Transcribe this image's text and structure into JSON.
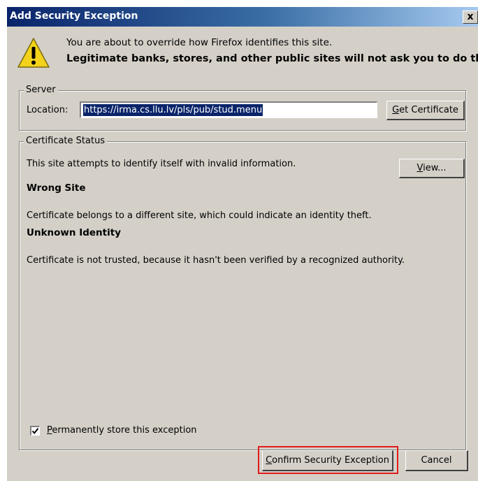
{
  "dialog": {
    "title": "Add Security Exception",
    "close_symbol": "x"
  },
  "intro": {
    "line1": "You are about to override how Firefox identifies this site.",
    "line2": "Legitimate banks, stores, and other public sites will not ask you to do this."
  },
  "icons": {
    "warning": "warning-icon",
    "check": "checkmark-icon"
  },
  "server": {
    "legend": "Server",
    "location_label": "Location:",
    "location_value": "https://irma.cs.llu.lv/pls/pub/stud.menu",
    "get_certificate": {
      "mnemonic": "G",
      "rest": "et Certificate"
    }
  },
  "certificate_status": {
    "legend": "Certificate Status",
    "summary": "This site attempts to identify itself with invalid information.",
    "view_button": {
      "mnemonic": "V",
      "rest": "iew..."
    },
    "problems": [
      {
        "heading": "Wrong Site",
        "detail": "Certificate belongs to a different site, which could indicate an identity theft."
      },
      {
        "heading": "Unknown Identity",
        "detail": "Certificate is not trusted, because it hasn't been verified by a recognized authority."
      }
    ]
  },
  "permanent_store": {
    "checked": true,
    "mnemonic": "P",
    "rest": "ermanently store this exception"
  },
  "buttons": {
    "confirm": {
      "mnemonic": "C",
      "rest": "onfirm Security Exception"
    },
    "cancel": "Cancel"
  },
  "colors": {
    "title_bar_start": "#0a246a",
    "dialog_background": "#d4d0c8",
    "highlight_outline": "#e21b1b",
    "warning_fill": "#f2d21b"
  }
}
